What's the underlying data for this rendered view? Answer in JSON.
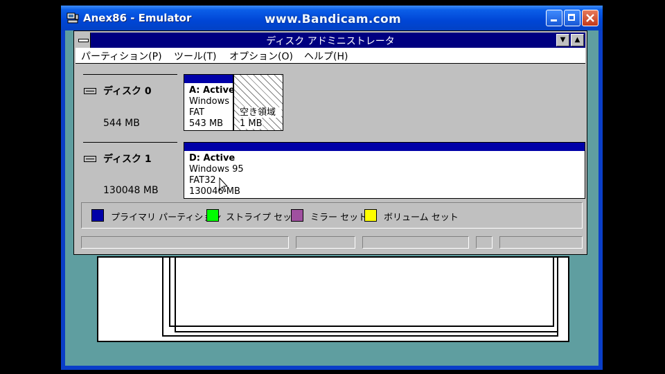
{
  "outer_window": {
    "title": "Anex86 - Emulator",
    "watermark": "www.Bandicam.com",
    "buttons": {
      "minimize": "_",
      "maximize": "□",
      "close": "✕"
    }
  },
  "disk_admin": {
    "title": "ディスク アドミニストレータ",
    "menu": [
      {
        "label": "パーティション(P)"
      },
      {
        "label": "ツール(T)"
      },
      {
        "label": "オプション(O)"
      },
      {
        "label": "ヘルプ(H)"
      }
    ],
    "disks": [
      {
        "label": "ディスク 0",
        "size": "544 MB",
        "partitions": [
          {
            "lines": [
              "A: Active",
              "Windows",
              "FAT",
              "543 MB"
            ]
          },
          {
            "lines": [
              "空き領域",
              "1 MB"
            ],
            "free": true
          }
        ]
      },
      {
        "label": "ディスク 1",
        "size": "130048 MB",
        "partitions": [
          {
            "lines": [
              "D: Active",
              "Windows 95",
              "FAT32",
              "130046 MB"
            ]
          }
        ]
      }
    ],
    "legend": [
      {
        "label": "プライマリ パーティション",
        "color": "#0000a8"
      },
      {
        "label": "ストライプ セット",
        "color": "#00ff00"
      },
      {
        "label": "ミラー セット",
        "color": "#a050a0"
      },
      {
        "label": "ボリューム セット",
        "color": "#ffff00"
      }
    ]
  },
  "colors": {
    "desktop": "#5f9ea0",
    "title_bar": "#000080",
    "partition_band": "#0000a8"
  }
}
